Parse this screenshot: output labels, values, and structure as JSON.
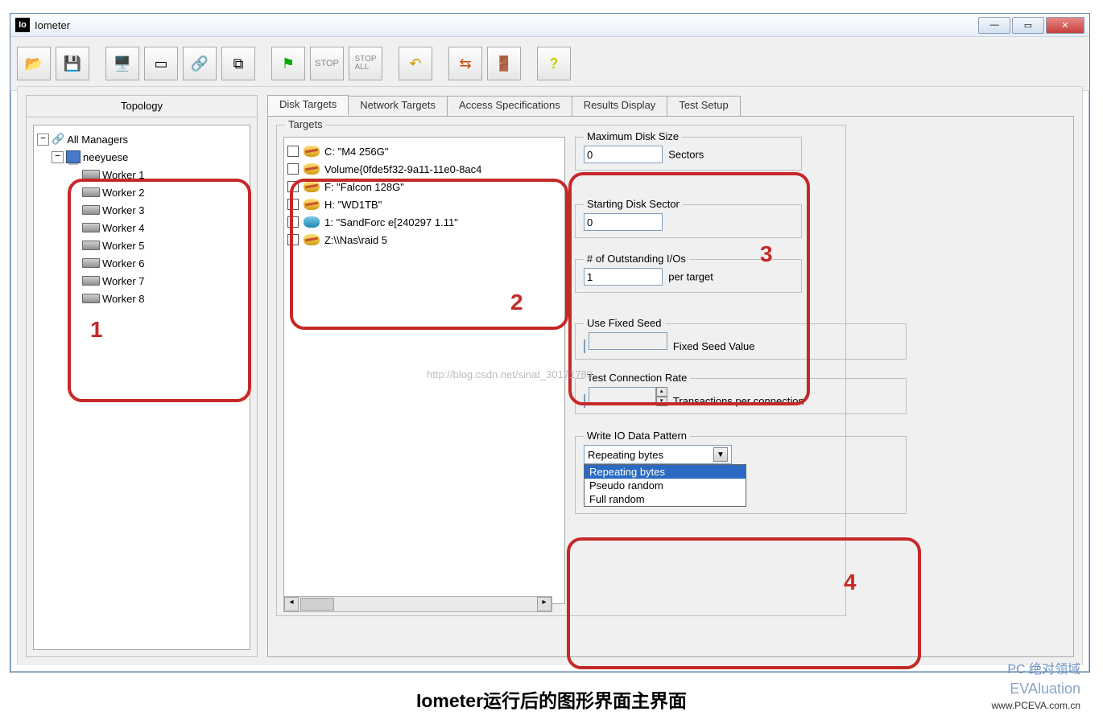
{
  "window": {
    "title": "Iometer"
  },
  "toolbar": {
    "open": "open-icon",
    "save": "save-icon",
    "pc": "pc-icon",
    "worker": "worker-icon",
    "network": "net-icon",
    "copy": "copy-icon",
    "start": "start-flag-icon",
    "stop": "stop-icon",
    "stopall": "stop-all-icon",
    "reset": "reset-icon",
    "edit": "edit-icon",
    "exit": "exit-icon",
    "help": "help-icon"
  },
  "topology": {
    "header": "Topology",
    "root": "All Managers",
    "manager": "neeyuese",
    "workers": [
      "Worker 1",
      "Worker 2",
      "Worker 3",
      "Worker 4",
      "Worker 5",
      "Worker 6",
      "Worker 7",
      "Worker 8"
    ]
  },
  "tabs": [
    "Disk Targets",
    "Network Targets",
    "Access Specifications",
    "Results Display",
    "Test Setup"
  ],
  "targets": {
    "legend": "Targets",
    "items": [
      {
        "icon": "y",
        "label": "C: \"M4 256G\""
      },
      {
        "icon": "y",
        "label": "Volume{0fde5f32-9a11-11e0-8ac4"
      },
      {
        "icon": "y",
        "label": "F: \"Falcon 128G\""
      },
      {
        "icon": "y",
        "label": "H: \"WD1TB\""
      },
      {
        "icon": "b",
        "label": "1: \"SandForc e[240297 1.11\""
      },
      {
        "icon": "y",
        "label": "Z:\\\\Nas\\raid 5"
      }
    ]
  },
  "settings": {
    "maxDisk": {
      "legend": "Maximum Disk Size",
      "value": "0",
      "unit": "Sectors"
    },
    "startSector": {
      "legend": "Starting Disk Sector",
      "value": "0"
    },
    "outstanding": {
      "legend": "# of Outstanding I/Os",
      "value": "1",
      "unit": "per target"
    },
    "fixedSeed": {
      "legend": "Use Fixed Seed",
      "label": "Fixed Seed Value"
    },
    "connRate": {
      "legend": "Test Connection Rate",
      "label": "Transactions per connection"
    },
    "pattern": {
      "legend": "Write IO Data Pattern",
      "value": "Repeating bytes",
      "options": [
        "Repeating bytes",
        "Pseudo random",
        "Full random"
      ]
    }
  },
  "annotations": {
    "1": "1",
    "2": "2",
    "3": "3",
    "4": "4"
  },
  "caption": "Iometer运行后的图形界面主界面",
  "watermark": {
    "line1": "PC 绝对领域",
    "line2": "EVAluation",
    "line3": "www.PCEVA.com.cn"
  },
  "csdn": "http://blog.csdn.net/sinat_30171789"
}
